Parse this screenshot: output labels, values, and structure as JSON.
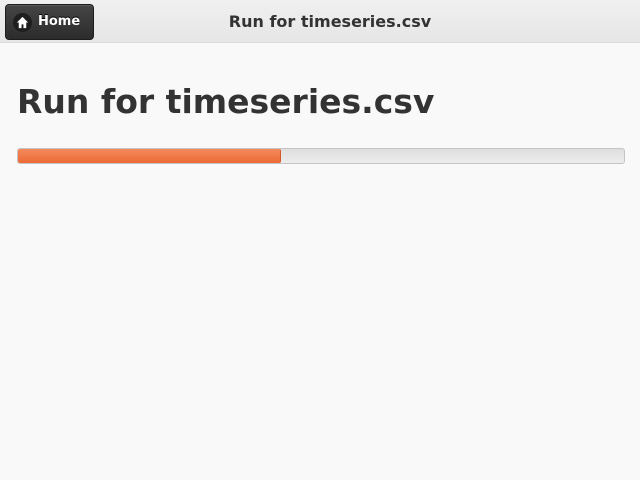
{
  "header": {
    "home_label": "Home",
    "title": "Run for timeseries.csv"
  },
  "main": {
    "page_title": "Run for timeseries.csv",
    "progress": {
      "fraction": 0.434,
      "fill_color": "#ec6a35",
      "track_color": "#e4e4e4"
    }
  },
  "icons": {
    "home": "home-icon"
  },
  "colors": {
    "header_bg": "#e9e9e9",
    "page_bg": "#f9f9f9",
    "button_bg": "#333333",
    "accent": "#ec6a35"
  }
}
